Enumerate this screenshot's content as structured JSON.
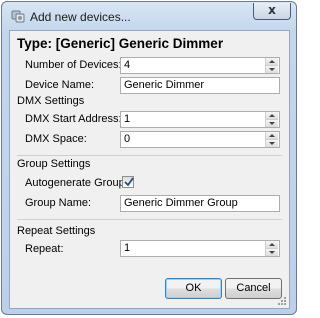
{
  "window": {
    "title": "Add new devices...",
    "close_label": "x"
  },
  "heading": "Type: [Generic] Generic Dimmer",
  "fields": {
    "number_of_devices": {
      "label": "Number of Devices:",
      "value": "4"
    },
    "device_name": {
      "label": "Device Name:",
      "value": "Generic Dimmer"
    }
  },
  "dmx": {
    "section_label": "DMX Settings",
    "start_address": {
      "label": "DMX Start Address:",
      "value": "1"
    },
    "space": {
      "label": "DMX Space:",
      "value": "0"
    }
  },
  "group": {
    "section_label": "Group Settings",
    "autogenerate": {
      "label": "Autogenerate Group:",
      "checked": true
    },
    "group_name": {
      "label": "Group Name:",
      "value": "Generic Dimmer Group"
    }
  },
  "repeat": {
    "section_label": "Repeat Settings",
    "repeat": {
      "label": "Repeat:",
      "value": "1"
    }
  },
  "buttons": {
    "ok_label": "OK",
    "cancel_label": "Cancel"
  },
  "icons": {
    "app": "devices-icon",
    "close": "close-icon",
    "check": "checkmark-icon",
    "grip": "resize-grip-icon"
  }
}
